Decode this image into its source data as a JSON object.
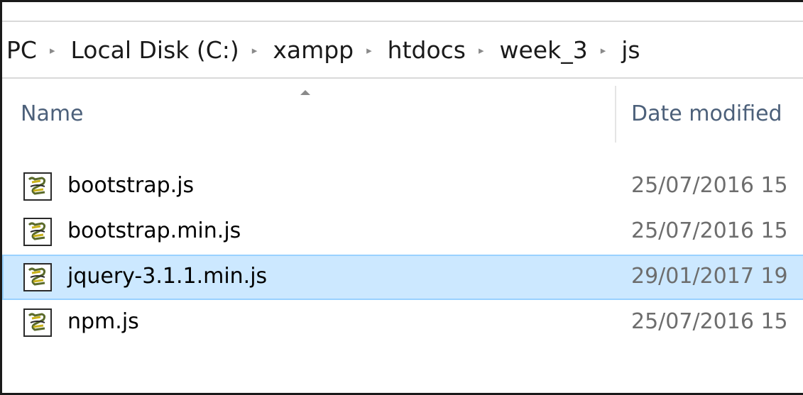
{
  "breadcrumb": {
    "items": [
      "PC",
      "Local Disk (C:)",
      "xampp",
      "htdocs",
      "week_3",
      "js"
    ],
    "separator_icon": "chevron-right-small"
  },
  "columns": {
    "name": "Name",
    "date_modified": "Date modified",
    "sort_indicator_icon": "sort-ascending-arrow"
  },
  "files": [
    {
      "name": "bootstrap.js",
      "date": "25/07/2016 15",
      "icon": "js-script-file-icon",
      "selected": false
    },
    {
      "name": "bootstrap.min.js",
      "date": "25/07/2016 15",
      "icon": "js-script-file-icon",
      "selected": false
    },
    {
      "name": "jquery-3.1.1.min.js",
      "date": "29/01/2017 19",
      "icon": "js-script-file-icon",
      "selected": true
    },
    {
      "name": "npm.js",
      "date": "25/07/2016 15",
      "icon": "js-script-file-icon",
      "selected": false
    }
  ],
  "colors": {
    "selection_bg": "#cce8ff",
    "selection_border": "#99d1ff",
    "header_text": "#4c607a",
    "date_text": "#6d6d6d"
  }
}
